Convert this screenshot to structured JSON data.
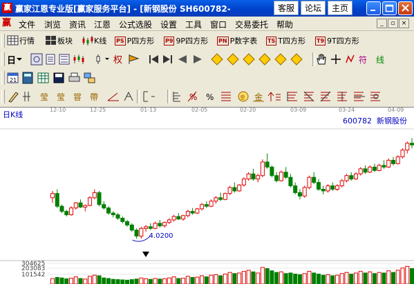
{
  "window": {
    "title": "赢家江恩专业版[赢家服务平台] - [新钢股份  SH600782-",
    "links": [
      "客服",
      "论坛",
      "主页"
    ]
  },
  "menu": [
    "文件",
    "浏览",
    "资讯",
    "江恩",
    "公式选股",
    "设置",
    "工具",
    "窗口",
    "交易委托",
    "帮助"
  ],
  "toolbar1": [
    {
      "badge": "",
      "label": "行情"
    },
    {
      "badge": "",
      "label": "板块"
    },
    {
      "badge": "",
      "label": "K线"
    },
    {
      "badge": "PS",
      "label": "P四方形"
    },
    {
      "badge": "P9",
      "label": "9P四方形"
    },
    {
      "badge": "PN",
      "label": "P数字表"
    },
    {
      "badge": "TS",
      "label": "T四方形"
    },
    {
      "badge": "T9",
      "label": "9T四方形"
    }
  ],
  "toolbar2_first": "日",
  "chart_data": {
    "type": "candlestick",
    "period_label": "日K线",
    "stock": {
      "code": "600782",
      "name": "新钢股份"
    },
    "x_dates": [
      "12-10",
      "12-25",
      "01-13",
      "02-05",
      "02-20",
      "03-09",
      "03-24",
      "04-09"
    ],
    "annotation": "4.0200",
    "volume_ticks": [
      "304625",
      "203083",
      "101542"
    ],
    "y_range": [
      3.9,
      5.3
    ],
    "volume_range": [
      0,
      400000
    ],
    "candles": [
      [
        4.5,
        4.58,
        4.44,
        4.55,
        98000
      ],
      [
        4.55,
        4.6,
        4.38,
        4.4,
        120000
      ],
      [
        4.4,
        4.42,
        4.32,
        4.34,
        110000
      ],
      [
        4.34,
        4.36,
        4.28,
        4.3,
        95000
      ],
      [
        4.3,
        4.4,
        4.29,
        4.38,
        105000
      ],
      [
        4.38,
        4.45,
        4.36,
        4.44,
        130000
      ],
      [
        4.44,
        4.48,
        4.38,
        4.39,
        100000
      ],
      [
        4.39,
        4.42,
        4.34,
        4.41,
        90000
      ],
      [
        4.41,
        4.52,
        4.4,
        4.5,
        140000
      ],
      [
        4.5,
        4.6,
        4.48,
        4.56,
        160000
      ],
      [
        4.56,
        4.58,
        4.4,
        4.42,
        150000
      ],
      [
        4.42,
        4.46,
        4.36,
        4.38,
        110000
      ],
      [
        4.38,
        4.4,
        4.3,
        4.32,
        100000
      ],
      [
        4.32,
        4.34,
        4.27,
        4.3,
        85000
      ],
      [
        4.3,
        4.32,
        4.24,
        4.26,
        80000
      ],
      [
        4.26,
        4.28,
        4.2,
        4.22,
        75000
      ],
      [
        4.22,
        4.24,
        4.16,
        4.18,
        70000
      ],
      [
        4.18,
        4.2,
        4.1,
        4.12,
        80000
      ],
      [
        4.12,
        4.14,
        4.02,
        4.05,
        90000
      ],
      [
        4.05,
        4.16,
        4.02,
        4.14,
        110000
      ],
      [
        4.14,
        4.18,
        4.1,
        4.16,
        95000
      ],
      [
        4.16,
        4.2,
        4.12,
        4.14,
        85000
      ],
      [
        4.14,
        4.22,
        4.13,
        4.2,
        100000
      ],
      [
        4.2,
        4.24,
        4.15,
        4.17,
        90000
      ],
      [
        4.17,
        4.22,
        4.15,
        4.21,
        95000
      ],
      [
        4.21,
        4.26,
        4.19,
        4.24,
        110000
      ],
      [
        4.24,
        4.3,
        4.22,
        4.28,
        130000
      ],
      [
        4.28,
        4.32,
        4.24,
        4.25,
        100000
      ],
      [
        4.25,
        4.3,
        4.23,
        4.29,
        105000
      ],
      [
        4.29,
        4.36,
        4.27,
        4.34,
        140000
      ],
      [
        4.34,
        4.38,
        4.3,
        4.32,
        120000
      ],
      [
        4.32,
        4.38,
        4.31,
        4.37,
        125000
      ],
      [
        4.37,
        4.44,
        4.35,
        4.42,
        150000
      ],
      [
        4.42,
        4.46,
        4.38,
        4.4,
        130000
      ],
      [
        4.4,
        4.48,
        4.39,
        4.46,
        160000
      ],
      [
        4.46,
        4.52,
        4.43,
        4.5,
        170000
      ],
      [
        4.5,
        4.56,
        4.46,
        4.48,
        150000
      ],
      [
        4.48,
        4.56,
        4.47,
        4.55,
        180000
      ],
      [
        4.55,
        4.64,
        4.53,
        4.62,
        210000
      ],
      [
        4.62,
        4.68,
        4.56,
        4.58,
        190000
      ],
      [
        4.58,
        4.66,
        4.57,
        4.65,
        200000
      ],
      [
        4.65,
        4.74,
        4.63,
        4.72,
        230000
      ],
      [
        4.72,
        4.8,
        4.7,
        4.78,
        250000
      ],
      [
        4.78,
        4.84,
        4.7,
        4.72,
        220000
      ],
      [
        4.72,
        4.78,
        4.68,
        4.76,
        200000
      ],
      [
        4.76,
        4.95,
        4.74,
        4.92,
        300000
      ],
      [
        4.92,
        5.02,
        4.84,
        4.86,
        280000
      ],
      [
        4.86,
        4.88,
        4.74,
        4.76,
        240000
      ],
      [
        4.76,
        4.8,
        4.68,
        4.7,
        210000
      ],
      [
        4.7,
        4.82,
        4.69,
        4.8,
        220000
      ],
      [
        4.8,
        4.86,
        4.72,
        4.74,
        190000
      ],
      [
        4.74,
        4.78,
        4.62,
        4.64,
        200000
      ],
      [
        4.64,
        4.68,
        4.54,
        4.56,
        180000
      ],
      [
        4.56,
        4.6,
        4.48,
        4.52,
        170000
      ],
      [
        4.52,
        4.64,
        4.5,
        4.62,
        190000
      ],
      [
        4.62,
        4.76,
        4.6,
        4.74,
        230000
      ],
      [
        4.74,
        4.8,
        4.66,
        4.68,
        200000
      ],
      [
        4.68,
        4.72,
        4.58,
        4.6,
        180000
      ],
      [
        4.6,
        4.64,
        4.54,
        4.58,
        160000
      ],
      [
        4.58,
        4.66,
        4.56,
        4.64,
        170000
      ],
      [
        4.64,
        4.68,
        4.58,
        4.6,
        150000
      ],
      [
        4.6,
        4.66,
        4.58,
        4.64,
        160000
      ],
      [
        4.64,
        4.72,
        4.62,
        4.7,
        190000
      ],
      [
        4.7,
        4.78,
        4.68,
        4.76,
        210000
      ],
      [
        4.76,
        4.8,
        4.7,
        4.72,
        180000
      ],
      [
        4.72,
        4.8,
        4.71,
        4.78,
        200000
      ],
      [
        4.78,
        4.86,
        4.76,
        4.84,
        230000
      ],
      [
        4.84,
        4.88,
        4.78,
        4.8,
        200000
      ],
      [
        4.8,
        4.88,
        4.79,
        4.86,
        220000
      ],
      [
        4.86,
        4.9,
        4.8,
        4.82,
        190000
      ],
      [
        4.82,
        4.9,
        4.81,
        4.88,
        210000
      ],
      [
        4.88,
        4.94,
        4.84,
        4.86,
        200000
      ],
      [
        4.86,
        4.96,
        4.85,
        4.94,
        240000
      ],
      [
        4.94,
        4.98,
        4.88,
        4.9,
        210000
      ],
      [
        4.9,
        5.0,
        4.89,
        4.98,
        250000
      ],
      [
        4.98,
        5.08,
        4.96,
        5.06,
        290000
      ],
      [
        5.06,
        5.16,
        5.02,
        5.14,
        320000
      ],
      [
        5.14,
        5.2,
        5.08,
        5.12,
        280000
      ]
    ]
  }
}
